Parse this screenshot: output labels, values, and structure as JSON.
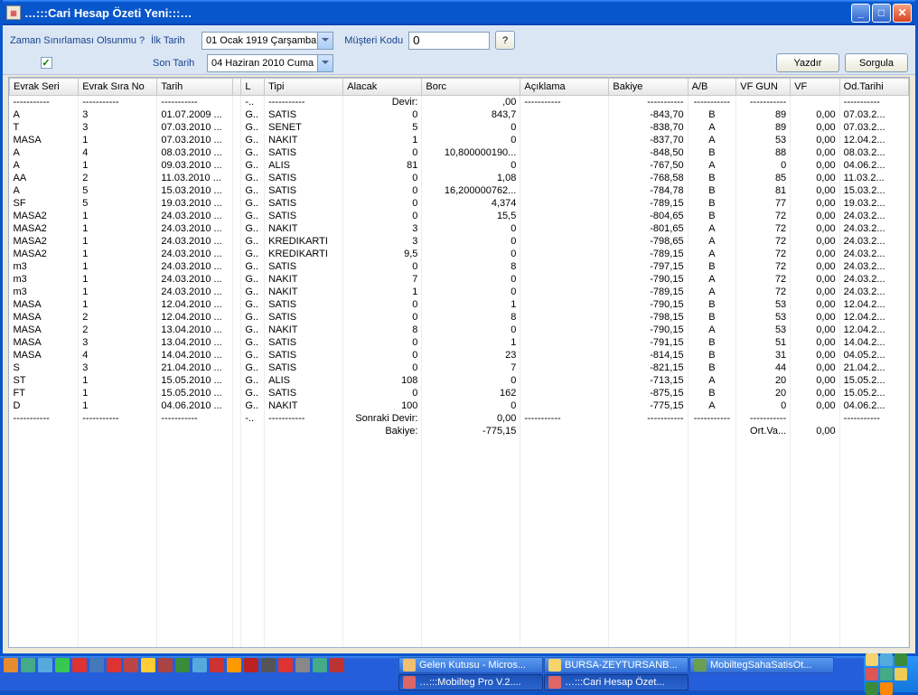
{
  "window": {
    "title": "…:::Cari Hesap Özeti Yeni:::…"
  },
  "toolbar": {
    "zaman_label": "Zaman Sınırlaması Olsunmu ?",
    "ilk_tarih_label": "İlk Tarih",
    "son_tarih_label": "Son Tarih",
    "ilk_tarih_value": "01   Ocak    1919  Çarşamba",
    "son_tarih_value": "04  Haziran  2010    Cuma",
    "musteri_label": "Müşteri Kodu",
    "musteri_value": "0",
    "help": "?",
    "yazdir": "Yazdır",
    "sorgula": "Sorgula"
  },
  "columns": [
    "Evrak Seri",
    "Evrak Sıra No",
    "Tarih",
    "",
    "L",
    "Tipi",
    "Alacak",
    "Borc",
    "Açıklama",
    "Bakiye",
    "A/B",
    "VF GUN",
    "VF",
    "Od.Tarihi"
  ],
  "separator": "-----------",
  "devir_label": "Devir:",
  "devir_borc": ",00",
  "sonraki_devir_label": "Sonraki Devir:",
  "sonraki_devir_val": "0,00",
  "bakiye_label": "Bakiye:",
  "bakiye_val": "-775,15",
  "ort_vade": "Ort.Va...",
  "ort_vf": "0,00",
  "rows": [
    {
      "seri": "A",
      "no": "3",
      "tarih": "01.07.2009 ...",
      "l": "G..",
      "tipi": "SATIS",
      "alacak": "0",
      "borc": "843,7",
      "bakiye": "-843,70",
      "ab": "B",
      "vfgun": "89",
      "vf": "0,00",
      "od": "07.03.2..."
    },
    {
      "seri": "T",
      "no": "3",
      "tarih": "07.03.2010 ...",
      "l": "G..",
      "tipi": "SENET",
      "alacak": "5",
      "borc": "0",
      "bakiye": "-838,70",
      "ab": "A",
      "vfgun": "89",
      "vf": "0,00",
      "od": "07.03.2..."
    },
    {
      "seri": "MASA",
      "no": "1",
      "tarih": "07.03.2010 ...",
      "l": "G..",
      "tipi": "NAKIT",
      "alacak": "1",
      "borc": "0",
      "bakiye": "-837,70",
      "ab": "A",
      "vfgun": "53",
      "vf": "0,00",
      "od": "12.04.2..."
    },
    {
      "seri": "A",
      "no": "4",
      "tarih": "08.03.2010 ...",
      "l": "G..",
      "tipi": "SATIS",
      "alacak": "0",
      "borc": "10,800000190...",
      "bakiye": "-848,50",
      "ab": "B",
      "vfgun": "88",
      "vf": "0,00",
      "od": "08.03.2..."
    },
    {
      "seri": "A",
      "no": "1",
      "tarih": "09.03.2010 ...",
      "l": "G..",
      "tipi": "ALIS",
      "alacak": "81",
      "borc": "0",
      "bakiye": "-767,50",
      "ab": "A",
      "vfgun": "0",
      "vf": "0,00",
      "od": "04.06.2..."
    },
    {
      "seri": "AA",
      "no": "2",
      "tarih": "11.03.2010 ...",
      "l": "G..",
      "tipi": "SATIS",
      "alacak": "0",
      "borc": "1,08",
      "bakiye": "-768,58",
      "ab": "B",
      "vfgun": "85",
      "vf": "0,00",
      "od": "11.03.2..."
    },
    {
      "seri": "A",
      "no": "5",
      "tarih": "15.03.2010 ...",
      "l": "G..",
      "tipi": "SATIS",
      "alacak": "0",
      "borc": "16,200000762...",
      "bakiye": "-784,78",
      "ab": "B",
      "vfgun": "81",
      "vf": "0,00",
      "od": "15.03.2..."
    },
    {
      "seri": "SF",
      "no": "5",
      "tarih": "19.03.2010 ...",
      "l": "G..",
      "tipi": "SATIS",
      "alacak": "0",
      "borc": "4,374",
      "bakiye": "-789,15",
      "ab": "B",
      "vfgun": "77",
      "vf": "0,00",
      "od": "19.03.2..."
    },
    {
      "seri": "MASA2",
      "no": "1",
      "tarih": "24.03.2010 ...",
      "l": "G..",
      "tipi": "SATIS",
      "alacak": "0",
      "borc": "15,5",
      "bakiye": "-804,65",
      "ab": "B",
      "vfgun": "72",
      "vf": "0,00",
      "od": "24.03.2..."
    },
    {
      "seri": "MASA2",
      "no": "1",
      "tarih": "24.03.2010 ...",
      "l": "G..",
      "tipi": "NAKIT",
      "alacak": "3",
      "borc": "0",
      "bakiye": "-801,65",
      "ab": "A",
      "vfgun": "72",
      "vf": "0,00",
      "od": "24.03.2..."
    },
    {
      "seri": "MASA2",
      "no": "1",
      "tarih": "24.03.2010 ...",
      "l": "G..",
      "tipi": "KREDIKARTI",
      "alacak": "3",
      "borc": "0",
      "bakiye": "-798,65",
      "ab": "A",
      "vfgun": "72",
      "vf": "0,00",
      "od": "24.03.2..."
    },
    {
      "seri": "MASA2",
      "no": "1",
      "tarih": "24.03.2010 ...",
      "l": "G..",
      "tipi": "KREDIKARTI",
      "alacak": "9,5",
      "borc": "0",
      "bakiye": "-789,15",
      "ab": "A",
      "vfgun": "72",
      "vf": "0,00",
      "od": "24.03.2..."
    },
    {
      "seri": "m3",
      "no": "1",
      "tarih": "24.03.2010 ...",
      "l": "G..",
      "tipi": "SATIS",
      "alacak": "0",
      "borc": "8",
      "bakiye": "-797,15",
      "ab": "B",
      "vfgun": "72",
      "vf": "0,00",
      "od": "24.03.2..."
    },
    {
      "seri": "m3",
      "no": "1",
      "tarih": "24.03.2010 ...",
      "l": "G..",
      "tipi": "NAKIT",
      "alacak": "7",
      "borc": "0",
      "bakiye": "-790,15",
      "ab": "A",
      "vfgun": "72",
      "vf": "0,00",
      "od": "24.03.2..."
    },
    {
      "seri": "m3",
      "no": "1",
      "tarih": "24.03.2010 ...",
      "l": "G..",
      "tipi": "NAKIT",
      "alacak": "1",
      "borc": "0",
      "bakiye": "-789,15",
      "ab": "A",
      "vfgun": "72",
      "vf": "0,00",
      "od": "24.03.2..."
    },
    {
      "seri": "MASA",
      "no": "1",
      "tarih": "12.04.2010 ...",
      "l": "G..",
      "tipi": "SATIS",
      "alacak": "0",
      "borc": "1",
      "bakiye": "-790,15",
      "ab": "B",
      "vfgun": "53",
      "vf": "0,00",
      "od": "12.04.2..."
    },
    {
      "seri": "MASA",
      "no": "2",
      "tarih": "12.04.2010 ...",
      "l": "G..",
      "tipi": "SATIS",
      "alacak": "0",
      "borc": "8",
      "bakiye": "-798,15",
      "ab": "B",
      "vfgun": "53",
      "vf": "0,00",
      "od": "12.04.2..."
    },
    {
      "seri": "MASA",
      "no": "2",
      "tarih": "13.04.2010 ...",
      "l": "G..",
      "tipi": "NAKIT",
      "alacak": "8",
      "borc": "0",
      "bakiye": "-790,15",
      "ab": "A",
      "vfgun": "53",
      "vf": "0,00",
      "od": "12.04.2..."
    },
    {
      "seri": "MASA",
      "no": "3",
      "tarih": "13.04.2010 ...",
      "l": "G..",
      "tipi": "SATIS",
      "alacak": "0",
      "borc": "1",
      "bakiye": "-791,15",
      "ab": "B",
      "vfgun": "51",
      "vf": "0,00",
      "od": "14.04.2..."
    },
    {
      "seri": "MASA",
      "no": "4",
      "tarih": "14.04.2010 ...",
      "l": "G..",
      "tipi": "SATIS",
      "alacak": "0",
      "borc": "23",
      "bakiye": "-814,15",
      "ab": "B",
      "vfgun": "31",
      "vf": "0,00",
      "od": "04.05.2..."
    },
    {
      "seri": "S",
      "no": "3",
      "tarih": "21.04.2010 ...",
      "l": "G..",
      "tipi": "SATIS",
      "alacak": "0",
      "borc": "7",
      "bakiye": "-821,15",
      "ab": "B",
      "vfgun": "44",
      "vf": "0,00",
      "od": "21.04.2..."
    },
    {
      "seri": "ST",
      "no": "1",
      "tarih": "15.05.2010 ...",
      "l": "G..",
      "tipi": "ALIS",
      "alacak": "108",
      "borc": "0",
      "bakiye": "-713,15",
      "ab": "A",
      "vfgun": "20",
      "vf": "0,00",
      "od": "15.05.2..."
    },
    {
      "seri": "FT",
      "no": "1",
      "tarih": "15.05.2010 ...",
      "l": "G..",
      "tipi": "SATIS",
      "alacak": "0",
      "borc": "162",
      "bakiye": "-875,15",
      "ab": "B",
      "vfgun": "20",
      "vf": "0,00",
      "od": "15.05.2..."
    },
    {
      "seri": "D",
      "no": "1",
      "tarih": "04.06.2010 ...",
      "l": "G..",
      "tipi": "NAKIT",
      "alacak": "100",
      "borc": "0",
      "bakiye": "-775,15",
      "ab": "A",
      "vfgun": "0",
      "vf": "0,00",
      "od": "04.06.2..."
    }
  ],
  "taskbar": {
    "items": [
      {
        "label": "Gelen Kutusu - Micros...",
        "color": "#f0c070",
        "active": false
      },
      {
        "label": "BURSA-ZEYTURSANB...",
        "color": "#f5d36e",
        "active": false
      },
      {
        "label": "MobiltegSahaSatisOt...",
        "color": "#6a9f52",
        "active": false
      },
      {
        "label": "…:::Mobilteg Pro V.2....",
        "color": "#d66",
        "active": true
      },
      {
        "label": "…:::Cari Hesap Özet...",
        "color": "#d66",
        "active": true
      }
    ]
  }
}
